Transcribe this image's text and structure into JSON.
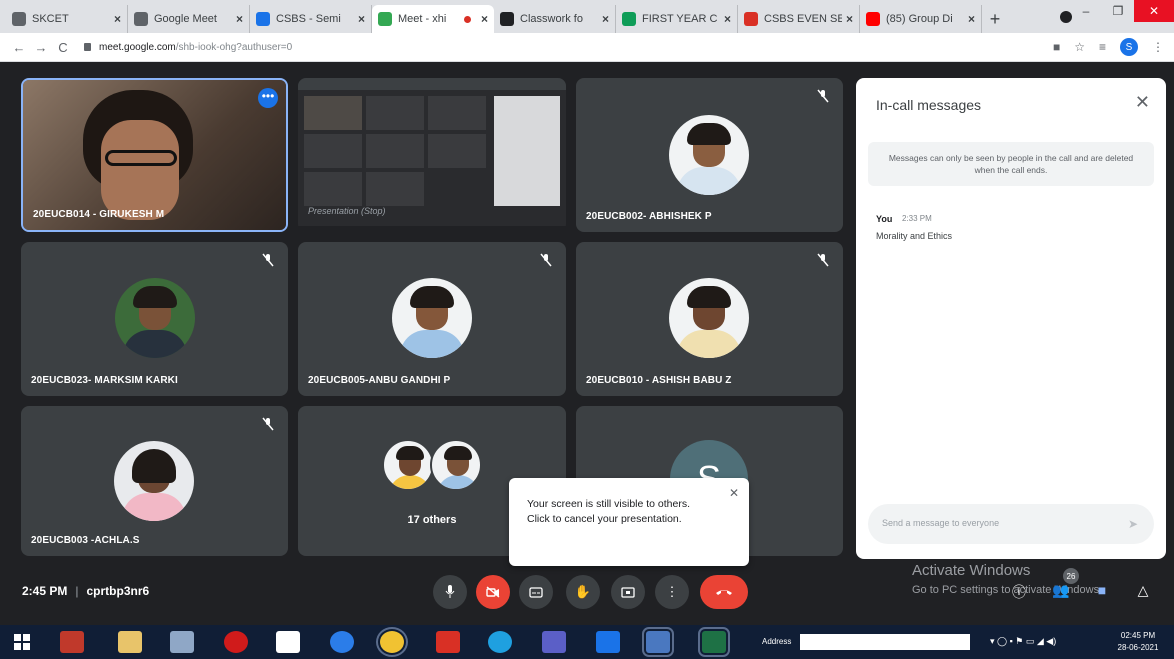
{
  "browser": {
    "tabs": [
      {
        "title": "SKCET",
        "color": "#5f6368"
      },
      {
        "title": "Google Meet",
        "color": "#5f6368"
      },
      {
        "title": "CSBS - Semi",
        "color": "#1a73e8"
      },
      {
        "title": "Meet - xhi",
        "color": "#34a853"
      },
      {
        "title": "Classwork fo",
        "color": "#202124"
      },
      {
        "title": "FIRST YEAR C",
        "color": "#0f9d58"
      },
      {
        "title": "CSBS EVEN SE",
        "color": "#d93025"
      },
      {
        "title": "(85) Group Di",
        "color": "#ff0000"
      }
    ],
    "url_host": "meet.google.com",
    "url_path": "/shb-iook-ohg?authuser=0",
    "profile_initial": "S"
  },
  "participants": [
    {
      "name": "20EUCB014 - GIRUKESH M"
    },
    {
      "name": ""
    },
    {
      "name": "20EUCB002- ABHISHEK P"
    },
    {
      "name": "20EUCB023- MARKSIM KARKI"
    },
    {
      "name": "20EUCB005-ANBU GANDHI P"
    },
    {
      "name": "20EUCB010 - ASHISH BABU Z"
    },
    {
      "name": "20EUCB003 -ACHLA.S"
    },
    {
      "name": "17 others"
    },
    {
      "name": "S"
    }
  ],
  "presentation_label": "Presentation (Stop)",
  "chat": {
    "title": "In-call messages",
    "notice": "Messages can only be seen by people in the call and are deleted when the call ends.",
    "sender": "You",
    "time": "2:33 PM",
    "message": "Morality and Ethics",
    "placeholder": "Send a message to everyone"
  },
  "popup": {
    "text": "Your screen is still visible to others. Click to cancel your presentation."
  },
  "meeting": {
    "time": "2:45 PM",
    "code": "cprtbp3nr6",
    "people_count": "26"
  },
  "watermark": {
    "line1": "Activate Windows",
    "line2": "Go to PC settings to activate Windows."
  },
  "taskbar": {
    "address_label": "Address",
    "clock_time": "02:45 PM",
    "clock_date": "28-06-2021"
  }
}
